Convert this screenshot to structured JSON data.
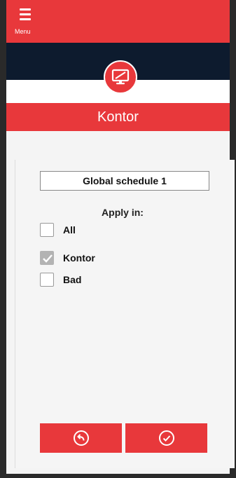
{
  "header": {
    "menu_label": "Menu"
  },
  "device": {
    "icon": "monitor-icon",
    "title": "Kontor"
  },
  "schedule": {
    "name": "Global schedule 1"
  },
  "apply": {
    "label": "Apply in:",
    "options": [
      {
        "label": "All",
        "checked": false
      },
      {
        "label": "Kontor",
        "checked": true
      },
      {
        "label": "Bad",
        "checked": false
      }
    ]
  },
  "actions": {
    "back_icon": "back-arrow-icon",
    "confirm_icon": "check-icon"
  },
  "colors": {
    "accent": "#e8383b",
    "navy": "#0d1b2e",
    "checked": "#b3b3b3"
  }
}
